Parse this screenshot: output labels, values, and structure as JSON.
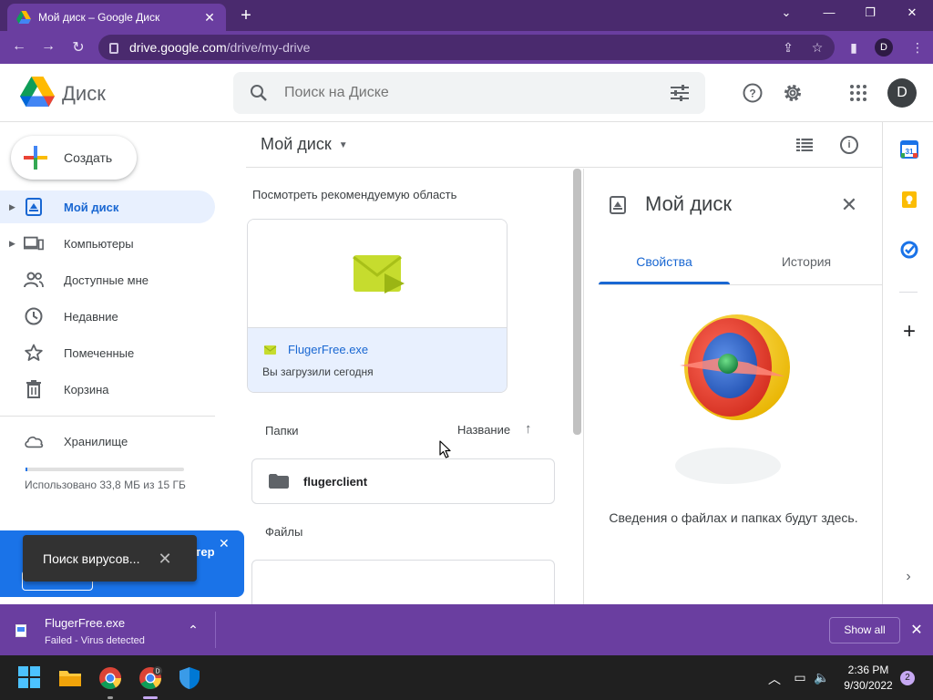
{
  "browser": {
    "tab_title": "Мой диск – Google Диск",
    "url_host": "drive.google.com",
    "url_path": "/drive/my-drive",
    "profile_initial": "D"
  },
  "header": {
    "brand": "Диск",
    "search_placeholder": "Поиск на Диске",
    "avatar_initial": "D"
  },
  "sidebar": {
    "create_label": "Создать",
    "items": [
      {
        "label": "Мой диск"
      },
      {
        "label": "Компьютеры"
      },
      {
        "label": "Доступные мне"
      },
      {
        "label": "Недавние"
      },
      {
        "label": "Помеченные"
      },
      {
        "label": "Корзина"
      }
    ],
    "storage_label": "Хранилище",
    "storage_used_text": "Использовано 33,8 МБ из 15 ГБ",
    "storage_fraction": 0.0022,
    "promo_fragment": "тер"
  },
  "toast": {
    "text": "Поиск вирусов..."
  },
  "main": {
    "title": "Мой диск",
    "suggested_label": "Посмотреть рекомендуемую область",
    "suggested_file": {
      "name": "FlugerFree.exe",
      "subtitle": "Вы загрузили сегодня"
    },
    "folders_label": "Папки",
    "sort_label": "Название",
    "folders": [
      {
        "name": "flugerclient"
      }
    ],
    "files_label": "Файлы"
  },
  "details": {
    "title": "Мой диск",
    "tabs": [
      {
        "label": "Свойства",
        "active": true
      },
      {
        "label": "История",
        "active": false
      }
    ],
    "empty_text": "Сведения о файлах и папках будут здесь."
  },
  "download": {
    "file_name": "FlugerFree.exe",
    "status": "Failed - Virus detected",
    "show_all_label": "Show all"
  },
  "taskbar": {
    "time": "2:36 PM",
    "date": "9/30/2022",
    "notification_count": "2"
  },
  "colors": {
    "browser_frame": "#6a3ea0",
    "accent_blue": "#1a73e8",
    "active_nav_bg": "#e8f0fe"
  }
}
